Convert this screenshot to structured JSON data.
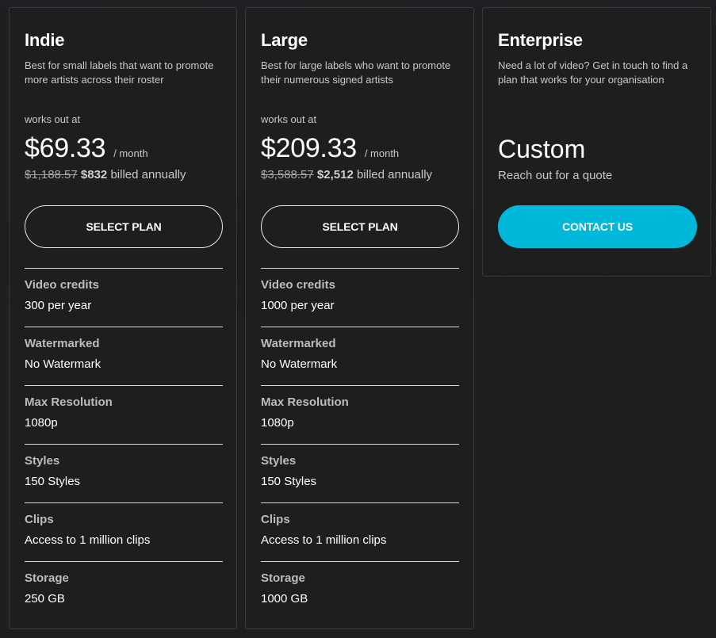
{
  "plans": [
    {
      "name": "Indie",
      "description": "Best for small labels that want to promote more artists across their roster",
      "works_out_label": "works out at",
      "price": "$69.33",
      "period": "/ month",
      "original_annual": "$1,188.57",
      "annual": "$832",
      "billed_label": "billed annually",
      "button_label": "SELECT PLAN",
      "features": [
        {
          "label": "Video credits",
          "value": "300 per year"
        },
        {
          "label": "Watermarked",
          "value": "No Watermark"
        },
        {
          "label": "Max Resolution",
          "value": "1080p"
        },
        {
          "label": "Styles",
          "value": "150 Styles"
        },
        {
          "label": "Clips",
          "value": "Access to 1 million clips"
        },
        {
          "label": "Storage",
          "value": "250 GB"
        }
      ]
    },
    {
      "name": "Large",
      "description": "Best for large labels who want to promote their numerous signed artists",
      "works_out_label": "works out at",
      "price": "$209.33",
      "period": "/ month",
      "original_annual": "$3,588.57",
      "annual": "$2,512",
      "billed_label": "billed annually",
      "button_label": "SELECT PLAN",
      "features": [
        {
          "label": "Video credits",
          "value": "1000 per year"
        },
        {
          "label": "Watermarked",
          "value": "No Watermark"
        },
        {
          "label": "Max Resolution",
          "value": "1080p"
        },
        {
          "label": "Styles",
          "value": "150 Styles"
        },
        {
          "label": "Clips",
          "value": "Access to 1 million clips"
        },
        {
          "label": "Storage",
          "value": "1000 GB"
        }
      ]
    },
    {
      "name": "Enterprise",
      "description": "Need a lot of video? Get in touch to find a plan that works for your organisation",
      "price": "Custom",
      "price_note": "Reach out for a quote",
      "button_label": "CONTACT US"
    }
  ],
  "colors": {
    "accent": "#00b8d9",
    "background": "#1e1e1e",
    "card_border": "#3a3a3a"
  }
}
